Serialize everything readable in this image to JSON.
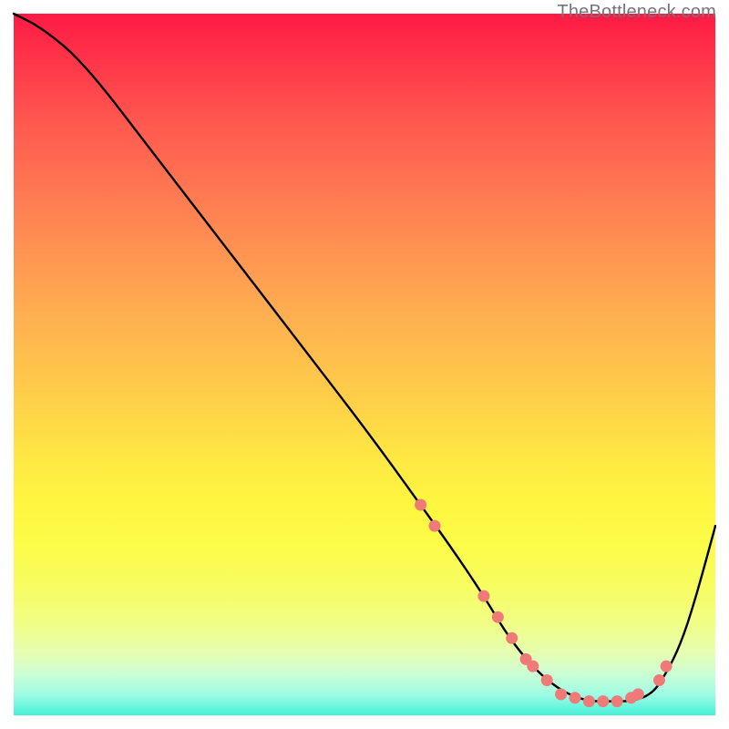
{
  "watermark": "TheBottleneck.com",
  "chart_data": {
    "type": "line",
    "title": "",
    "xlabel": "",
    "ylabel": "",
    "xlim": [
      0,
      100
    ],
    "ylim": [
      0,
      100
    ],
    "grid": false,
    "note": "No numeric axes or tick labels are rendered; values below are relative percentages estimated from the curve shape on a 0–100 virtual grid.",
    "series": [
      {
        "name": "bottleneck-curve",
        "color": "#000000",
        "x": [
          0,
          4,
          10,
          20,
          30,
          40,
          50,
          58,
          63,
          67,
          70,
          73,
          76,
          79,
          82,
          85,
          88,
          91,
          93,
          95,
          97,
          100
        ],
        "y": [
          100,
          98,
          93,
          80,
          67,
          54,
          41,
          30,
          23,
          17,
          12,
          8,
          5,
          3,
          2,
          2,
          2,
          3,
          6,
          10,
          16,
          27
        ]
      }
    ],
    "markers": {
      "name": "highlight-points",
      "color": "#f07a78",
      "points": [
        {
          "x": 58,
          "y": 30
        },
        {
          "x": 60,
          "y": 27
        },
        {
          "x": 67,
          "y": 17
        },
        {
          "x": 69,
          "y": 14
        },
        {
          "x": 71,
          "y": 11
        },
        {
          "x": 73,
          "y": 8
        },
        {
          "x": 74,
          "y": 7
        },
        {
          "x": 76,
          "y": 5
        },
        {
          "x": 78,
          "y": 3
        },
        {
          "x": 80,
          "y": 2.5
        },
        {
          "x": 82,
          "y": 2
        },
        {
          "x": 84,
          "y": 2
        },
        {
          "x": 86,
          "y": 2
        },
        {
          "x": 88,
          "y": 2.5
        },
        {
          "x": 89,
          "y": 3
        },
        {
          "x": 92,
          "y": 5
        },
        {
          "x": 93,
          "y": 7
        }
      ]
    },
    "background": {
      "type": "vertical-gradient",
      "stops": [
        {
          "pos": 0,
          "color": "#ff1a44"
        },
        {
          "pos": 50,
          "color": "#ffd248"
        },
        {
          "pos": 80,
          "color": "#fcfc4a"
        },
        {
          "pos": 100,
          "color": "#45f1d8"
        }
      ]
    }
  }
}
